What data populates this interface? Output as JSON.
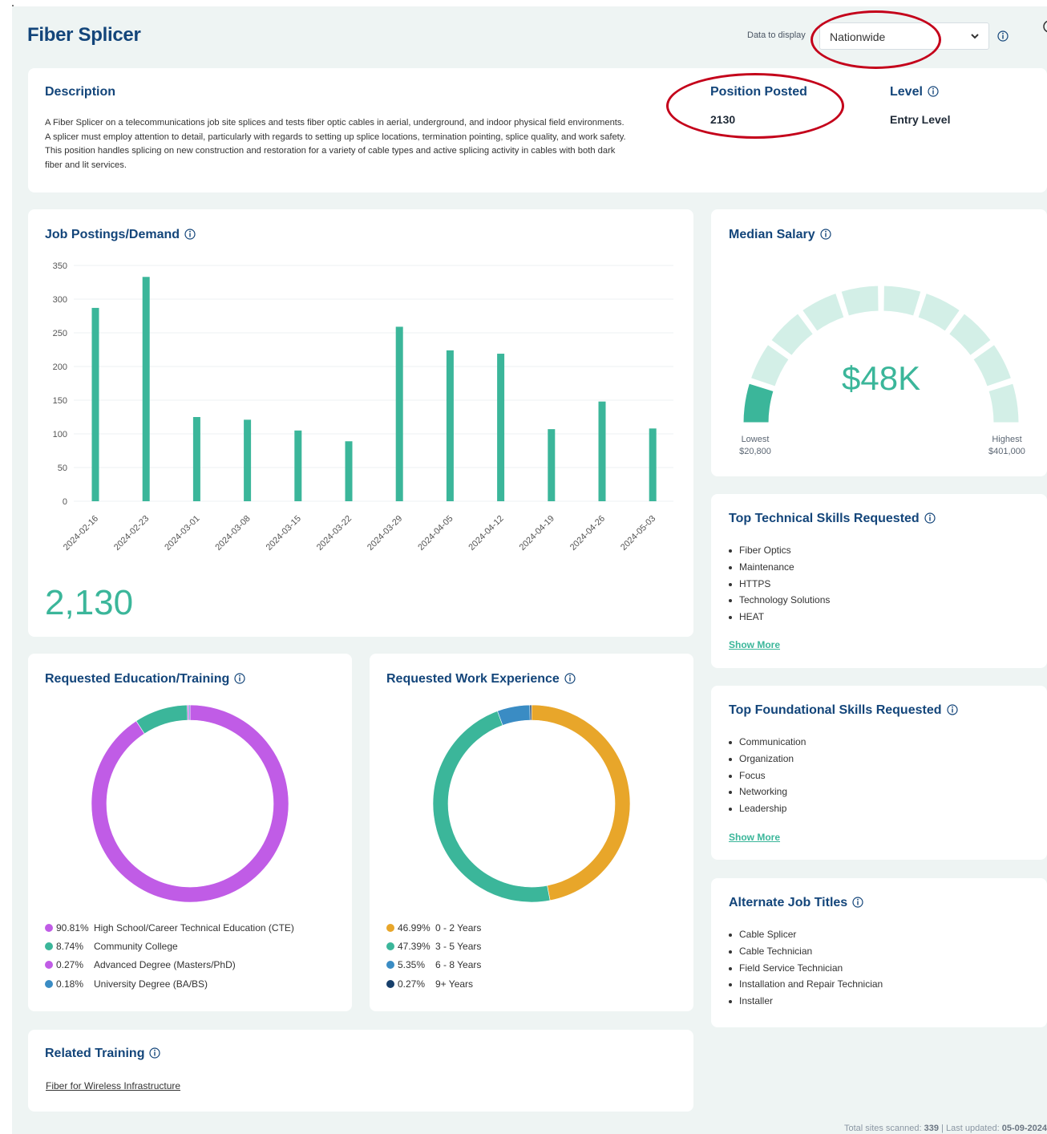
{
  "page": {
    "title": "Fiber Splicer"
  },
  "display": {
    "label": "Data to display",
    "value": "Nationwide"
  },
  "description": {
    "title": "Description",
    "text": "A Fiber Splicer on a telecommunications job site splices and tests fiber optic cables in aerial, underground, and indoor physical field environments. A splicer must employ attention to detail, particularly with regards to setting up splice locations, termination pointing, splice quality, and work safety. This position handles splicing on new construction and restoration for a variety of cable types and active splicing activity in cables with both dark fiber and lit services."
  },
  "position_posted": {
    "label": "Position Posted",
    "value": "2130"
  },
  "level": {
    "label": "Level",
    "value": "Entry Level"
  },
  "job_postings": {
    "title": "Job Postings/Demand",
    "total": "2,130"
  },
  "chart_data": [
    {
      "type": "bar",
      "categories": [
        "2024-02-16",
        "2024-02-23",
        "2024-03-01",
        "2024-03-08",
        "2024-03-15",
        "2024-03-22",
        "2024-03-29",
        "2024-04-05",
        "2024-04-12",
        "2024-04-19",
        "2024-04-26",
        "2024-05-03"
      ],
      "values": [
        287,
        333,
        125,
        121,
        105,
        89,
        259,
        224,
        219,
        107,
        148,
        108
      ],
      "yticks": [
        0,
        50,
        100,
        150,
        200,
        250,
        300,
        350
      ],
      "ylim": [
        0,
        350
      ],
      "color": "#3bb69a",
      "grid": true
    },
    {
      "type": "pie",
      "labels": [
        "High School/Career Technical Education (CTE)",
        "Community College",
        "Advanced Degree (Masters/PhD)",
        "University Degree (BA/BS)"
      ],
      "values": [
        90.81,
        8.74,
        0.27,
        0.18
      ],
      "colors": [
        "#c05ce6",
        "#3bb69a",
        "#c05ce6",
        "#3a8cc4"
      ],
      "donut": true
    },
    {
      "type": "pie",
      "labels": [
        "0 - 2 Years",
        "3 - 5 Years",
        "6 - 8 Years",
        "9+ Years"
      ],
      "values": [
        46.99,
        47.39,
        5.35,
        0.27
      ],
      "colors": [
        "#e8a62a",
        "#3bb69a",
        "#3a8cc4",
        "#173f6b"
      ],
      "donut": true
    }
  ],
  "median_salary": {
    "title": "Median Salary",
    "value": "$48K",
    "lowest_label": "Lowest",
    "lowest_value": "$20,800",
    "highest_label": "Highest",
    "highest_value": "$401,000",
    "filled_segments": 1,
    "segments": 10
  },
  "technical_skills": {
    "title": "Top Technical Skills Requested",
    "items": [
      "Fiber Optics",
      "Maintenance",
      "HTTPS",
      "Technology Solutions",
      "HEAT"
    ],
    "show_more": "Show More"
  },
  "foundational_skills": {
    "title": "Top Foundational Skills Requested",
    "items": [
      "Communication",
      "Organization",
      "Focus",
      "Networking",
      "Leadership"
    ],
    "show_more": "Show More"
  },
  "alternate_titles": {
    "title": "Alternate Job Titles",
    "items": [
      "Cable Splicer",
      "Cable Technician",
      "Field Service Technician",
      "Installation and Repair Technician",
      "Installer"
    ]
  },
  "education": {
    "title": "Requested Education/Training",
    "legend": [
      {
        "pct": "90.81%",
        "label": "High School/Career Technical Education (CTE)"
      },
      {
        "pct": "8.74%",
        "label": "Community College"
      },
      {
        "pct": "0.27%",
        "label": "Advanced Degree (Masters/PhD)"
      },
      {
        "pct": "0.18%",
        "label": "University Degree (BA/BS)"
      }
    ]
  },
  "experience": {
    "title": "Requested Work Experience",
    "legend": [
      {
        "pct": "46.99%",
        "label": "0 - 2 Years"
      },
      {
        "pct": "47.39%",
        "label": "3 - 5 Years"
      },
      {
        "pct": "5.35%",
        "label": "6 - 8 Years"
      },
      {
        "pct": "0.27%",
        "label": "9+ Years"
      }
    ]
  },
  "related_training": {
    "title": "Related Training",
    "link": "Fiber for Wireless Infrastructure"
  },
  "footer": {
    "sites_label": "Total sites scanned:",
    "sites_value": "339",
    "separator": "|",
    "updated_label": "Last updated:",
    "updated_value": "05-09-2024"
  },
  "colors": {
    "brand": "#13457a",
    "accent": "#3bb69a",
    "annotation": "#c4001a",
    "background": "#eef4f3"
  }
}
